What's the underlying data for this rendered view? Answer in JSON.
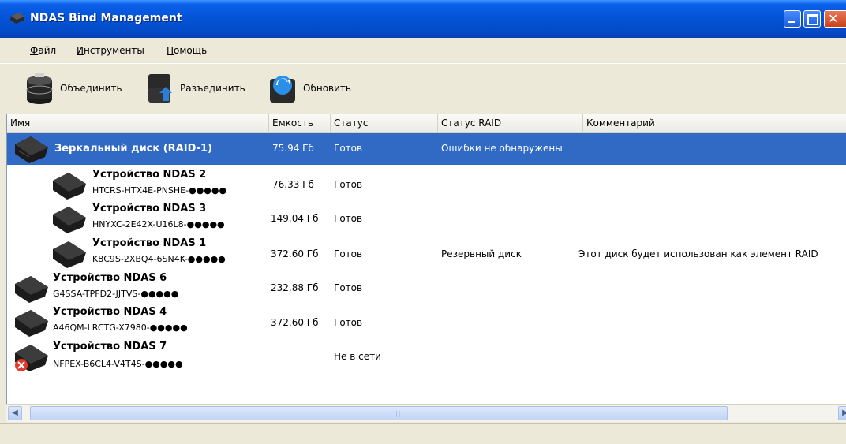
{
  "window": {
    "title": "NDAS Bind Management"
  },
  "menu": [
    {
      "label": "Файл",
      "underline": "Ф",
      "rest": "айл"
    },
    {
      "label": "Инструменты",
      "underline": "И",
      "rest": "нструменты"
    },
    {
      "label": "Помощь",
      "underline": "П",
      "rest": "омощь"
    }
  ],
  "toolbar": {
    "bind_label": "Объединить",
    "unbind_label": "Разъединить",
    "refresh_label": "Обновить"
  },
  "columns": {
    "name": "Имя",
    "capacity": "Емкость",
    "status": "Статус",
    "raid_status": "Статус RAID",
    "comment": "Комментарий"
  },
  "rows": [
    {
      "title": "Зеркальный диск (RAID-1)",
      "id": "",
      "capacity": "75.94 Гб",
      "status": "Готов",
      "raid_status": "Ошибки не обнаружены",
      "comment": "",
      "selected": true,
      "icon": "raid-disk-icon"
    },
    {
      "title": "Устройство NDAS 2",
      "id": "HTCRS-HTX4E-PNSHE-●●●●●",
      "capacity": "76.33 Гб",
      "status": "Готов",
      "raid_status": "",
      "comment": "",
      "icon": "ndas-device-icon"
    },
    {
      "title": "Устройство NDAS 3",
      "id": "HNYXC-2E42X-U16L8-●●●●●",
      "capacity": "149.04 Гб",
      "status": "Готов",
      "raid_status": "",
      "comment": "",
      "icon": "ndas-device-icon"
    },
    {
      "title": "Устройство NDAS 1",
      "id": "K8C9S-2XBQ4-6SN4K-●●●●●",
      "capacity": "372.60 Гб",
      "status": "Готов",
      "raid_status": "Резервный диск",
      "comment": "Этот диск будет использован как элемент RAID",
      "icon": "ndas-device-icon"
    },
    {
      "title": "Устройство NDAS 6",
      "id": "G4SSA-TPFD2-JJTVS-●●●●●",
      "capacity": "232.88 Гб",
      "status": "Готов",
      "raid_status": "",
      "comment": "",
      "icon": "ndas-device-icon"
    },
    {
      "title": "Устройство NDAS 4",
      "id": "A46QM-LRCTG-X7980-●●●●●",
      "capacity": "372.60 Гб",
      "status": "Готов",
      "raid_status": "",
      "comment": "",
      "icon": "ndas-device-icon"
    },
    {
      "title": "Устройство NDAS 7",
      "id": "NFPEX-B6CL4-V4T4S-●●●●●",
      "capacity": "",
      "status": "Не в сети",
      "raid_status": "",
      "comment": "",
      "icon": "ndas-device-offline-icon"
    }
  ],
  "scrollbar": {
    "grip": "|||"
  },
  "colors": {
    "selection": "#316ac5",
    "titlebar": "#0453d6",
    "window_bg": "#ece9d8"
  }
}
